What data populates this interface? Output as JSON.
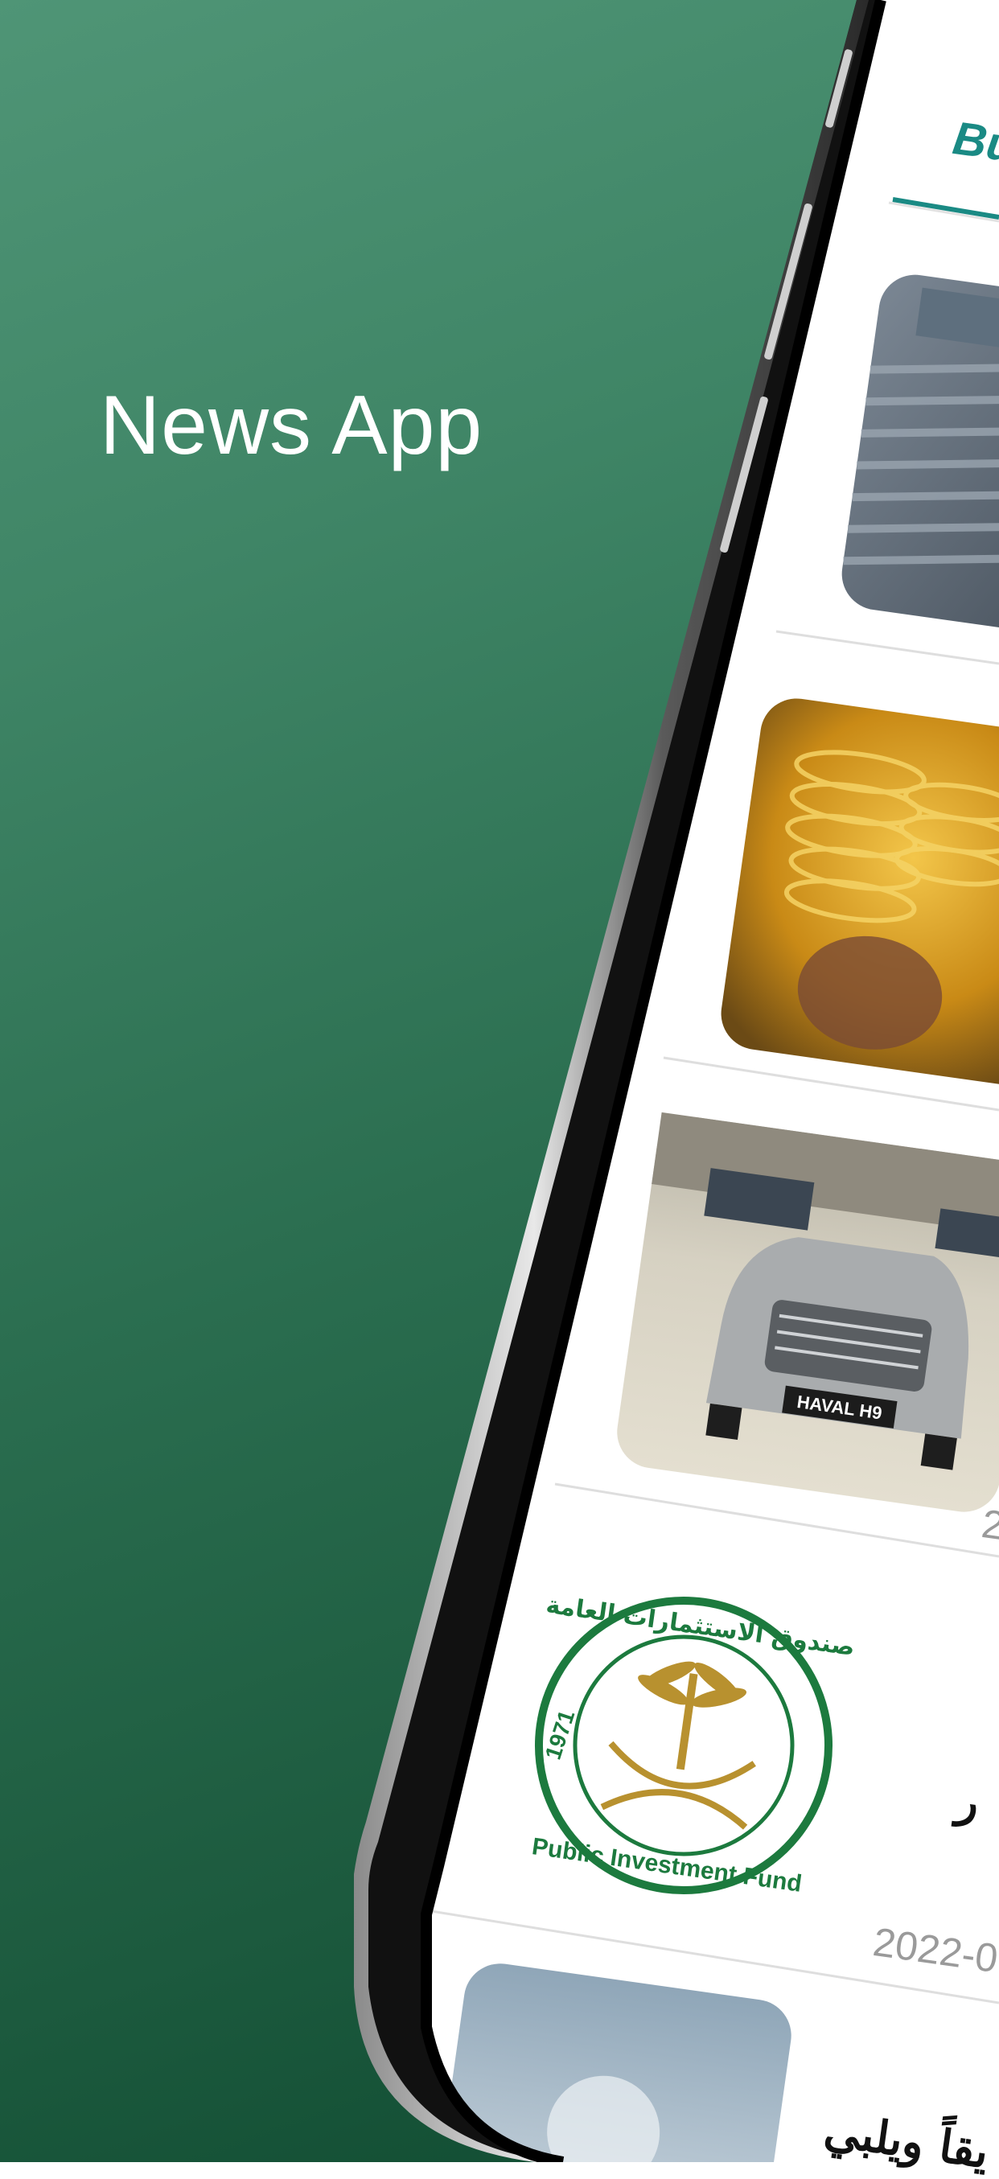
{
  "promo": {
    "headline": "News App"
  },
  "app": {
    "active_tab": "Bu",
    "articles": [
      {
        "image": "steel-rebar-photo",
        "date": ""
      },
      {
        "image": "gold-bangles-photo",
        "date": ""
      },
      {
        "image": "haval-h9-car-photo",
        "date": "2",
        "plate_text": "HAVAL H9"
      },
      {
        "image": "public-investment-fund-logo",
        "date": "2022-0",
        "headline_fragment": "ر",
        "logo_text_en": "Public Investment Fund",
        "logo_text_ar": "صندوق الاستثمارات العامة",
        "logo_year": "1971"
      },
      {
        "image": "article-photo",
        "headline_fragment": "يقاً ويلبي"
      }
    ]
  },
  "colors": {
    "accent": "#1a8a84",
    "bg_top": "#4f9576",
    "bg_bottom": "#0f4a30"
  }
}
